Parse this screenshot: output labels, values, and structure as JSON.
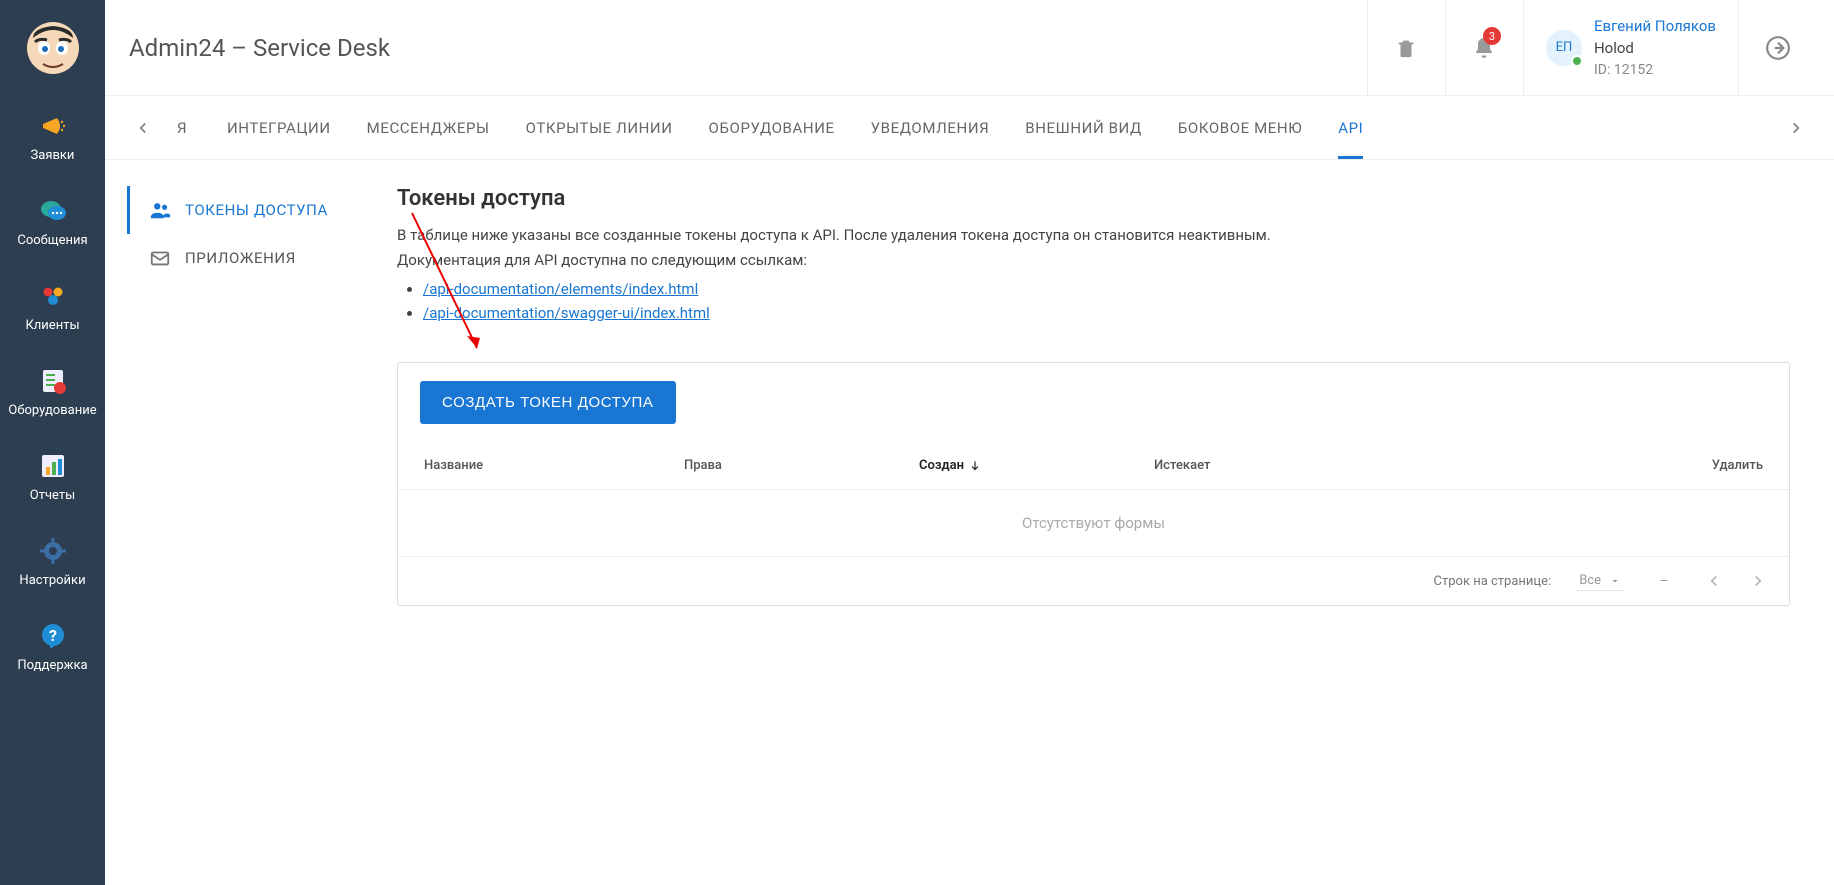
{
  "header": {
    "title": "Admin24 – Service Desk",
    "notification_count": "3",
    "user": {
      "initials": "ЕП",
      "name": "Евгений Поляков",
      "company": "Holod",
      "id_label": "ID: 12152"
    }
  },
  "sidebar": {
    "items": [
      {
        "key": "tickets",
        "label": "Заявки"
      },
      {
        "key": "messages",
        "label": "Сообщения"
      },
      {
        "key": "clients",
        "label": "Клиенты"
      },
      {
        "key": "equipment",
        "label": "Оборудование"
      },
      {
        "key": "reports",
        "label": "Отчеты"
      },
      {
        "key": "settings",
        "label": "Настройки"
      },
      {
        "key": "support",
        "label": "Поддержка"
      }
    ]
  },
  "tabs": {
    "truncated_first": "Я",
    "items": [
      "ИНТЕГРАЦИИ",
      "МЕССЕНДЖЕРЫ",
      "ОТКРЫТЫЕ ЛИНИИ",
      "ОБОРУДОВАНИЕ",
      "УВЕДОМЛЕНИЯ",
      "ВНЕШНИЙ ВИД",
      "БОКОВОЕ МЕНЮ",
      "API"
    ],
    "active_index": 7
  },
  "subnav": {
    "items": [
      {
        "label": "ТОКЕНЫ ДОСТУПА",
        "icon": "people-icon"
      },
      {
        "label": "ПРИЛОЖЕНИЯ",
        "icon": "mail-icon"
      }
    ],
    "active_index": 0
  },
  "content": {
    "heading": "Токены доступа",
    "desc_line1": "В таблице ниже указаны все созданные токены доступа к API. После удаления токена доступа он становится неактивным.",
    "desc_line2": "Документация для API доступна по следующим ссылкам:",
    "links": [
      "/api-documentation/elements/index.html",
      "/api-documentation/swagger-ui/index.html"
    ],
    "create_button": "СОЗДАТЬ ТОКЕН ДОСТУПА",
    "table": {
      "headers": {
        "name": "Название",
        "rights": "Права",
        "created": "Создан",
        "expires": "Истекает",
        "delete": "Удалить"
      },
      "empty": "Отсутствуют формы",
      "rows_label": "Строк на странице:",
      "rows_value": "Все",
      "page_range": "–"
    }
  }
}
